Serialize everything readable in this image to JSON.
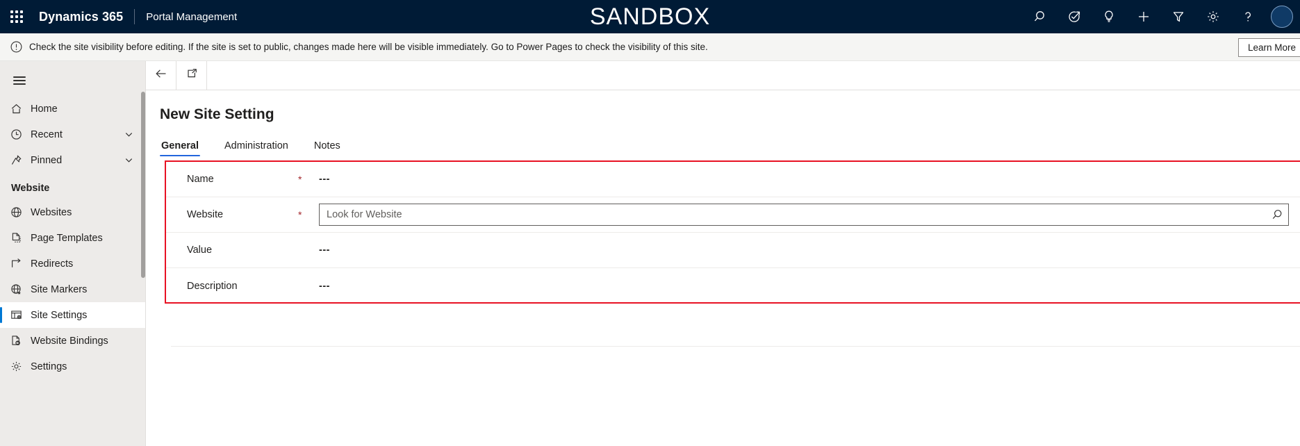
{
  "topbar": {
    "waffle_label": "app-launcher",
    "brand": "Dynamics 365",
    "app_name": "Portal Management",
    "environment_banner": "SANDBOX",
    "icons": [
      {
        "name": "search-icon",
        "title": "Search"
      },
      {
        "name": "launch-check-icon",
        "title": "Quick launch"
      },
      {
        "name": "lightbulb-icon",
        "title": "Ideas"
      },
      {
        "name": "plus-icon",
        "title": "New"
      },
      {
        "name": "filter-icon",
        "title": "Filter"
      },
      {
        "name": "gear-icon",
        "title": "Settings"
      },
      {
        "name": "help-icon",
        "title": "Help"
      }
    ],
    "avatar_label": "user-avatar"
  },
  "notification": {
    "icon": "info-circle-icon",
    "message": "Check the site visibility before editing. If the site is set to public, changes made here will be visible immediately. Go to Power Pages to check the visibility of this site.",
    "action_label": "Learn More"
  },
  "sidebar": {
    "menu_toggle_label": "Site map",
    "items": [
      {
        "label": "Home",
        "icon": "home-icon",
        "expandable": false,
        "selected": false
      },
      {
        "label": "Recent",
        "icon": "clock-icon",
        "expandable": true,
        "selected": false
      },
      {
        "label": "Pinned",
        "icon": "pin-icon",
        "expandable": true,
        "selected": false
      }
    ],
    "group_label": "Website",
    "group_items": [
      {
        "label": "Websites",
        "icon": "globe-icon",
        "selected": false
      },
      {
        "label": "Page Templates",
        "icon": "page-template-icon",
        "selected": false
      },
      {
        "label": "Redirects",
        "icon": "redirect-arrow-icon",
        "selected": false
      },
      {
        "label": "Site Markers",
        "icon": "globe-star-icon",
        "selected": false
      },
      {
        "label": "Site Settings",
        "icon": "site-settings-icon",
        "selected": true
      },
      {
        "label": "Website Bindings",
        "icon": "website-binding-icon",
        "selected": false
      },
      {
        "label": "Settings",
        "icon": "gear-icon",
        "selected": false
      }
    ]
  },
  "command_bar": {
    "back_label": "Back",
    "popout_label": "Open in new window"
  },
  "page": {
    "title": "New Site Setting",
    "tabs": [
      {
        "label": "General",
        "active": true
      },
      {
        "label": "Administration",
        "active": false
      },
      {
        "label": "Notes",
        "active": false
      }
    ]
  },
  "form": {
    "highlight_color": "#e81123",
    "required_marker": "*",
    "fields": [
      {
        "label": "Name",
        "required": true,
        "type": "text",
        "value": "---"
      },
      {
        "label": "Website",
        "required": true,
        "type": "lookup",
        "value": "",
        "placeholder": "Look for Website",
        "search_icon": "lookup-search-icon"
      },
      {
        "label": "Value",
        "required": false,
        "type": "text",
        "value": "---"
      },
      {
        "label": "Description",
        "required": false,
        "type": "text",
        "value": "---"
      }
    ]
  }
}
